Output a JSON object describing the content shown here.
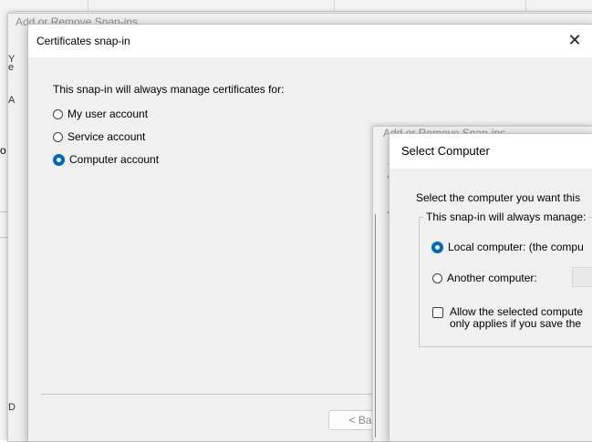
{
  "background_window": {
    "left_fragment": "o"
  },
  "snapins_dialog": {
    "title": "Add or Remove Snap-ins",
    "fragments": [
      "Y",
      "e",
      "A",
      "D"
    ]
  },
  "certificates_dialog": {
    "title": "Certificates snap-in",
    "intro": "This snap-in will always manage certificates for:",
    "options": [
      {
        "label": "My user account",
        "checked": false
      },
      {
        "label": "Service account",
        "checked": false
      },
      {
        "label": "Computer account",
        "checked": true
      }
    ],
    "back_button": "< Ba"
  },
  "snapins_dialog_2": {
    "title": "Add or Remove Snap-ins",
    "fragments": [
      "Y",
      "e",
      "A"
    ]
  },
  "select_computer_dialog": {
    "title": "Select Computer",
    "intro": "Select the computer you want this",
    "group_label": "This snap-in will always manage:",
    "options": [
      {
        "label": "Local computer:  (the compu",
        "checked": true
      },
      {
        "label": "Another computer:",
        "checked": false
      }
    ],
    "allow_checkbox": {
      "line1": "Allow the selected compute",
      "line2": "only applies if you save the",
      "checked": false
    }
  }
}
